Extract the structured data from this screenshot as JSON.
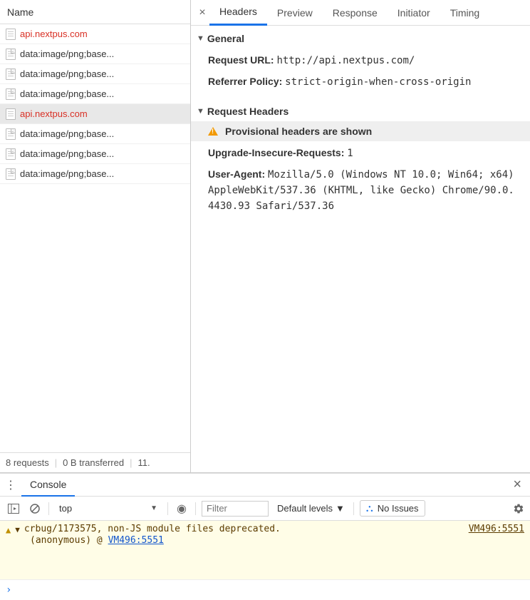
{
  "leftPane": {
    "header": "Name",
    "requests": [
      {
        "name": "api.nextpus.com",
        "error": true,
        "selected": false,
        "icon": "doc"
      },
      {
        "name": "data:image/png;base...",
        "error": false,
        "selected": false,
        "icon": "img"
      },
      {
        "name": "data:image/png;base...",
        "error": false,
        "selected": false,
        "icon": "img"
      },
      {
        "name": "data:image/png;base...",
        "error": false,
        "selected": false,
        "icon": "img"
      },
      {
        "name": "api.nextpus.com",
        "error": true,
        "selected": true,
        "icon": "doc"
      },
      {
        "name": "data:image/png;base...",
        "error": false,
        "selected": false,
        "icon": "img"
      },
      {
        "name": "data:image/png;base...",
        "error": false,
        "selected": false,
        "icon": "img"
      },
      {
        "name": "data:image/png;base...",
        "error": false,
        "selected": false,
        "icon": "img"
      }
    ],
    "status": {
      "requests": "8 requests",
      "transferred": "0 B transferred",
      "extra": "11."
    }
  },
  "tabs": [
    "Headers",
    "Preview",
    "Response",
    "Initiator",
    "Timing"
  ],
  "activeTab": "Headers",
  "sections": {
    "general": {
      "title": "General",
      "rows": [
        {
          "k": "Request URL:",
          "v": "http://api.nextpus.com/"
        },
        {
          "k": "Referrer Policy:",
          "v": "strict-origin-when-cross-origin"
        }
      ]
    },
    "requestHeaders": {
      "title": "Request Headers",
      "provisional": "Provisional headers are shown",
      "rows": [
        {
          "k": "Upgrade-Insecure-Requests:",
          "v": "1"
        },
        {
          "k": "User-Agent:",
          "v": "Mozilla/5.0 (Windows NT 10.0; Win64; x64) AppleWebKit/537.36 (KHTML, like Gecko) Chrome/90.0.4430.93 Safari/537.36"
        }
      ]
    }
  },
  "console": {
    "tab": "Console",
    "context": "top",
    "filterPlaceholder": "Filter",
    "levels": "Default levels",
    "issues": "No Issues",
    "message": "crbug/1173575, non-JS module files deprecated.",
    "source": "VM496:5551",
    "stackLabel": "(anonymous) @ ",
    "stackLink": "VM496:5551",
    "prompt": "›"
  }
}
